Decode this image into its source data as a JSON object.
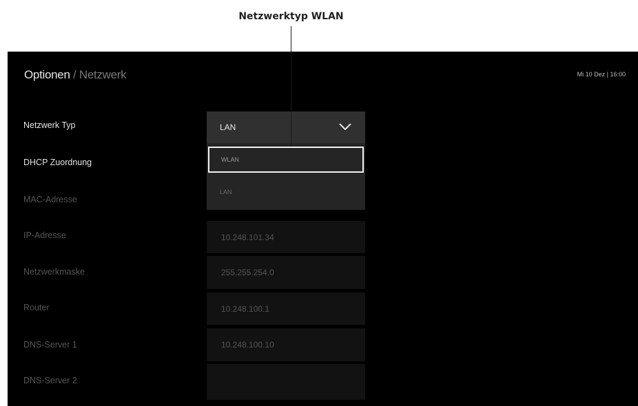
{
  "callout": {
    "label": "Netzwerktyp WLAN"
  },
  "header": {
    "current": "Optionen",
    "separator": "/",
    "section": "Netzwerk",
    "datetime": "Mi 10 Dez | 16:00"
  },
  "settings": {
    "network_type": {
      "label": "Netzwerk Typ",
      "value": "LAN",
      "icon": "chevron-down-icon"
    },
    "dhcp": {
      "label": "DHCP Zuordnung"
    },
    "mac": {
      "label": "MAC-Adresse"
    },
    "ip": {
      "label": "IP-Adresse",
      "value": "10.248.101.34"
    },
    "netmask": {
      "label": "Netzwerkmaske",
      "value": "255.255.254.0"
    },
    "router": {
      "label": "Router",
      "value": "10.248.100.1"
    },
    "dns1": {
      "label": "DNS-Server 1",
      "value": "10.248.100.10"
    },
    "dns2": {
      "label": "DNS-Server 2",
      "value": ""
    }
  },
  "dropdown": {
    "options": [
      "WLAN",
      "LAN"
    ],
    "focused": "WLAN"
  }
}
